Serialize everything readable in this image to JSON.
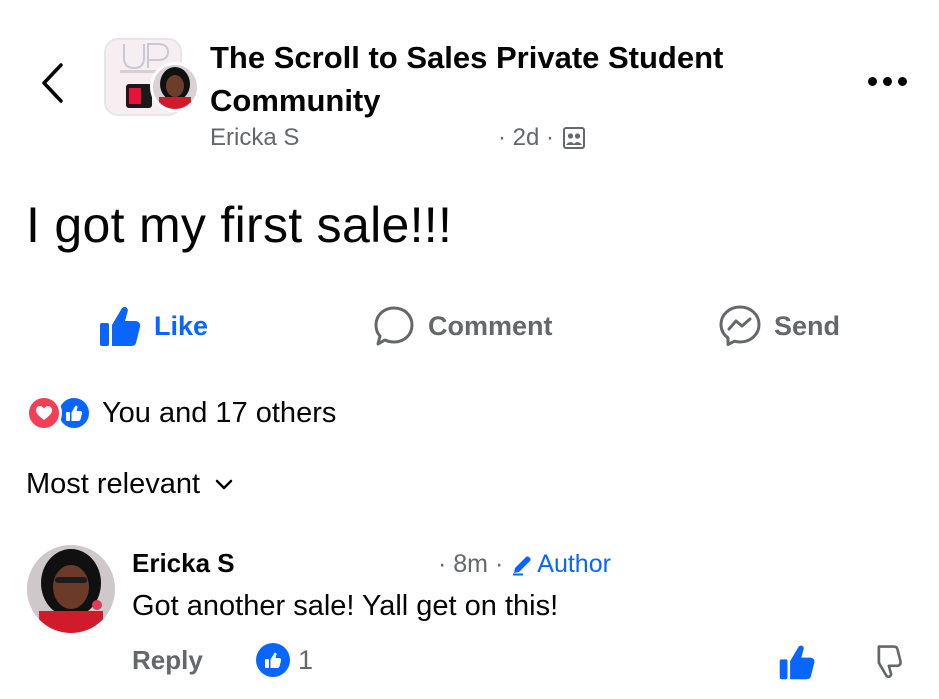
{
  "header": {
    "back_icon": "chevron-left-icon",
    "group_name": "The Scroll to Sales Private Student Community",
    "author": "Ericka S",
    "time": "· 2d ·",
    "audience_icon": "group-members-icon",
    "more_icon": "more-horizontal-icon"
  },
  "post": {
    "text": "I got my first sale!!!"
  },
  "actions": {
    "like": "Like",
    "comment": "Comment",
    "send": "Send"
  },
  "reactions": {
    "summary": "You and 17 others",
    "types": [
      "love",
      "like"
    ]
  },
  "comments_sort": {
    "label": "Most relevant"
  },
  "comment": {
    "author": "Ericka S",
    "time": "· 8m ·",
    "badge": "Author",
    "text": "Got another sale! Yall get on this!",
    "reply_label": "Reply",
    "like_count": "1"
  },
  "colors": {
    "facebook_blue": "#0866ff",
    "secondary_text": "#65676b",
    "love_red": "#f33e58"
  }
}
